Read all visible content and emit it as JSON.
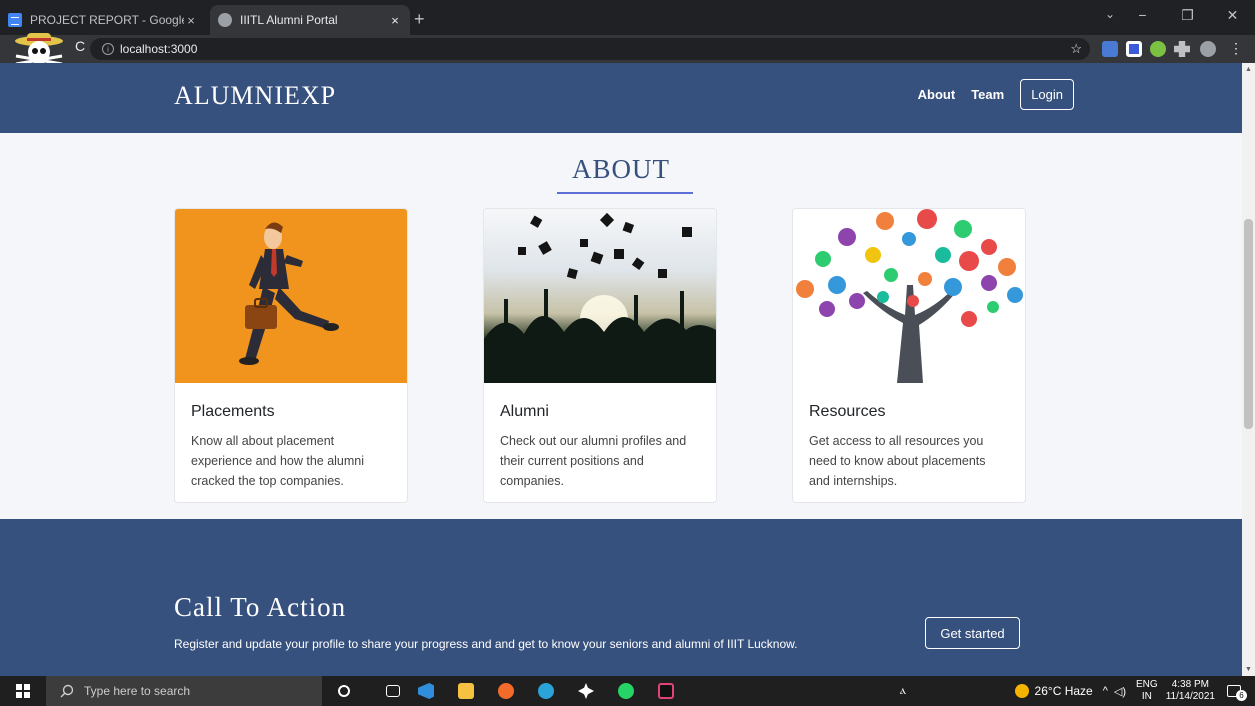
{
  "browser": {
    "tabs": [
      {
        "title": "PROJECT REPORT - Google Docs",
        "close": "×"
      },
      {
        "title": "IIITL Alumni Portal",
        "close": "×"
      }
    ],
    "new_tab": "+",
    "url": "localhost:3000",
    "info_glyph": "i",
    "star": "☆",
    "back": "←",
    "reload": "C",
    "menu": "⋮",
    "tab_dropdown": "⌄",
    "window_controls": [
      "−",
      "❐",
      "✕"
    ]
  },
  "site": {
    "brand": "ALUMNIEXP",
    "nav": {
      "about": "About",
      "team": "Team",
      "login": "Login"
    }
  },
  "about": {
    "title": "ABOUT",
    "cards": [
      {
        "title": "Placements",
        "text": "Know all about placement experience and how the alumni cracked the top companies."
      },
      {
        "title": "Alumni",
        "text": "Check out our alumni profiles and their current positions and companies."
      },
      {
        "title": "Resources",
        "text": "Get access to all resources you need to know about placements and internships."
      }
    ]
  },
  "cta": {
    "title": "Call To Action",
    "text": "Register and update your profile to share your progress and and get to know your seniors and alumni of IIIT Lucknow.",
    "button": "Get started"
  },
  "taskbar": {
    "search_placeholder": "Type here to search",
    "weather": "26°C Haze",
    "lang": "ENG",
    "region": "IN",
    "time": "4:38 PM",
    "date": "11/14/2021",
    "notif_count": "6"
  }
}
